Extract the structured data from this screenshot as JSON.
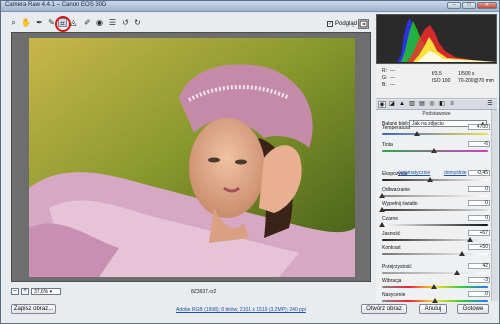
{
  "window": {
    "title": "Camera Raw 4.4.1 – Canon EOS 30D"
  },
  "toolbar": {
    "tools": [
      "zoom-icon",
      "hand-icon",
      "white-balance-icon",
      "color-sampler-icon",
      "crop-icon",
      "straighten-icon",
      "retouch-icon",
      "redeye-icon",
      "preferences-icon",
      "rotate-left-icon",
      "rotate-right-icon"
    ],
    "preview_label": "Podgląd",
    "preview_checked": true
  },
  "preview": {
    "zoom": "37,6%",
    "filename": "8Z3637.cr2"
  },
  "info": {
    "r_label": "R:",
    "g_label": "G:",
    "b_label": "B:",
    "r_value": "---",
    "g_value": "---",
    "b_value": "---",
    "aperture": "f/3,5",
    "shutter": "1/500 s",
    "iso": "ISO 100",
    "lens": "70-200@70 mm"
  },
  "panel": {
    "title": "Podstawowe",
    "wb_label": "Balans bieli:",
    "wb_value": "Jak na zdjęciu",
    "auto_link": "automatycznie",
    "default_link": "domyślnie",
    "sliders": [
      {
        "label": "Temperatura",
        "value": "4700",
        "pos": 0.33
      },
      {
        "label": "Tinta",
        "value": "-6",
        "pos": 0.49
      },
      {
        "label": "Ekspozycja",
        "value": "-0,45",
        "pos": 0.45
      },
      {
        "label": "Odtwarzanie",
        "value": "0",
        "pos": 0.0
      },
      {
        "label": "Wypełnij światło",
        "value": "0",
        "pos": 0.0
      },
      {
        "label": "Czarne",
        "value": "0",
        "pos": 0.0
      },
      {
        "label": "Jasność",
        "value": "+67",
        "pos": 0.83
      },
      {
        "label": "Kontrast",
        "value": "+50",
        "pos": 0.75
      },
      {
        "label": "Przejrzystość",
        "value": "42",
        "pos": 0.71
      },
      {
        "label": "Wibracja",
        "value": "-3",
        "pos": 0.49
      },
      {
        "label": "Nasycenie",
        "value": "0",
        "pos": 0.5
      }
    ]
  },
  "bottom": {
    "save_label": "Zapisz obraz...",
    "workflow_link": "Adobe RGB (1998); 8 bitów; 2101 x 1519 (3,2MP); 240 ppi",
    "open_label": "Otwórz obraz",
    "cancel_label": "Anuluj",
    "done_label": "Gotowe"
  }
}
